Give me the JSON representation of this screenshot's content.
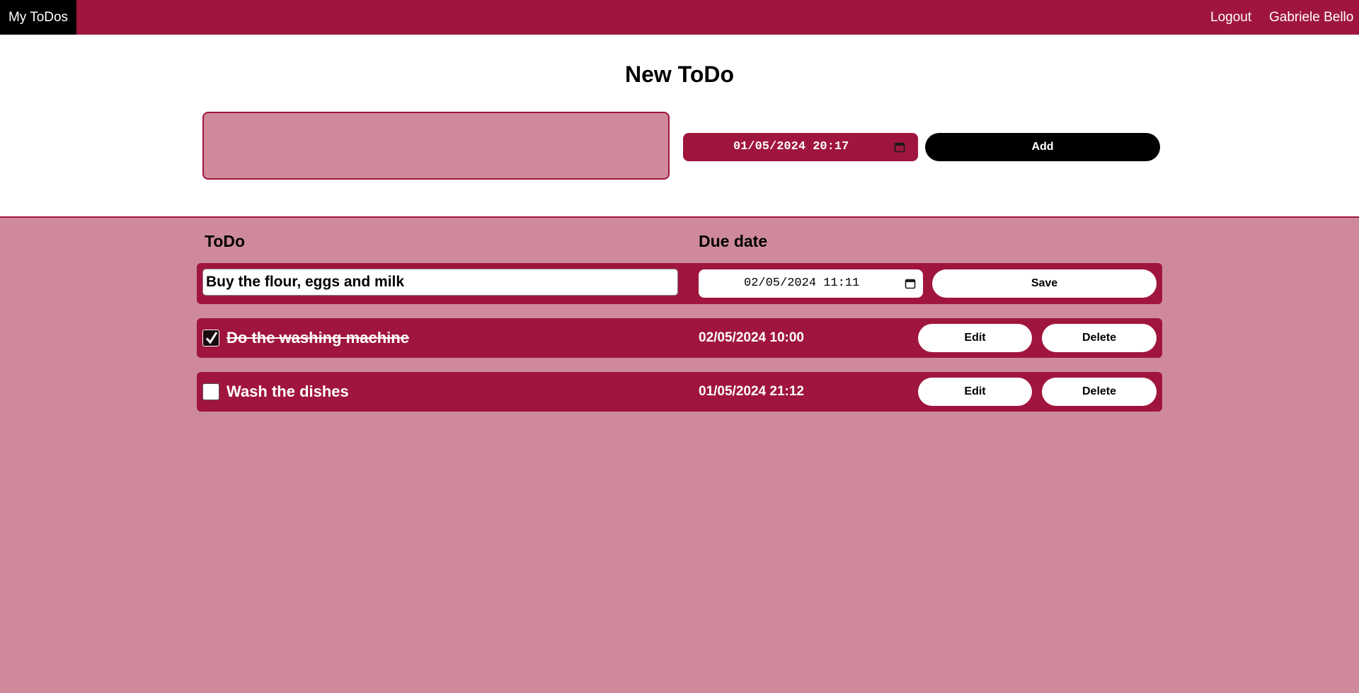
{
  "navbar": {
    "brand": "My ToDos",
    "logout": "Logout",
    "user": "Gabriele Bello"
  },
  "new_todo": {
    "title": "New ToDo",
    "text_value": "",
    "due_value": "01/05/2024 20:17",
    "add_label": "Add"
  },
  "list": {
    "col_todo": "ToDo",
    "col_due": "Due date",
    "editing": {
      "text": "Buy the flour, eggs and milk",
      "due": "02/05/2024 11:11",
      "save_label": "Save"
    },
    "items": [
      {
        "text": "Do the washing machine",
        "due": "02/05/2024 10:00",
        "done": true,
        "edit_label": "Edit",
        "delete_label": "Delete"
      },
      {
        "text": "Wash the dishes",
        "due": "01/05/2024 21:12",
        "done": false,
        "edit_label": "Edit",
        "delete_label": "Delete"
      }
    ]
  },
  "colors": {
    "primary": "#a0153e",
    "background": "#ce8a9b",
    "brand_bg": "#000000",
    "white": "#ffffff"
  }
}
